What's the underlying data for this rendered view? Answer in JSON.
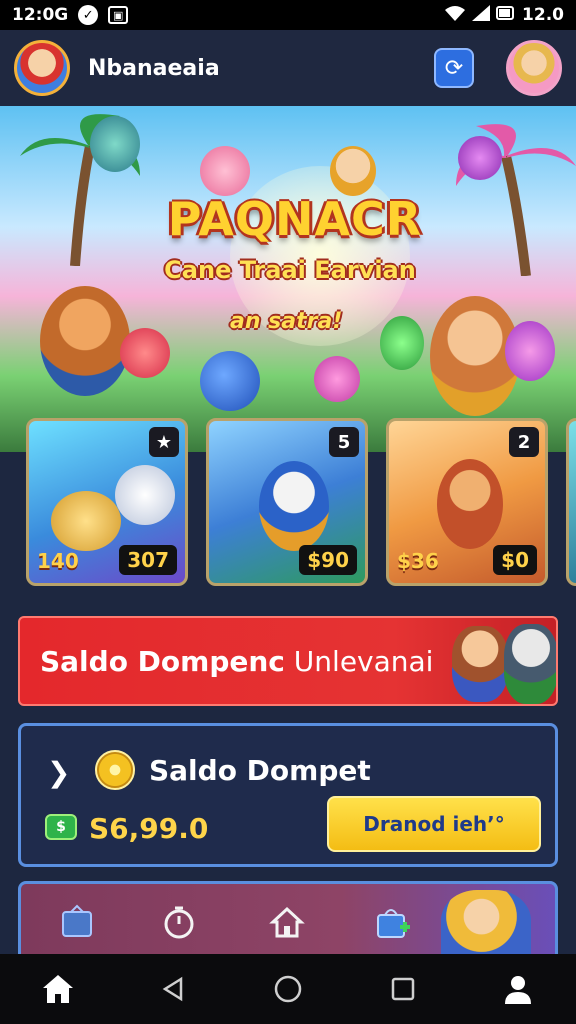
{
  "status_bar": {
    "time": "12:0G",
    "right_text": "12.0"
  },
  "header": {
    "title": "Nbanaeaia"
  },
  "hero": {
    "title": "PAQNACR",
    "subtitle": "Cane Traai Earvian",
    "tagline": "an satra!"
  },
  "cards": [
    {
      "badge": "★",
      "left_value": "140",
      "price": "307"
    },
    {
      "badge": "5",
      "left_value": "",
      "price": "$90"
    },
    {
      "badge": "2",
      "left_value": "$36",
      "price": "$0"
    }
  ],
  "promo": {
    "bold_text": "Saldo Dompenc",
    "thin_text": " Unlevanai"
  },
  "wallet": {
    "title": "Saldo Dompet",
    "amount": "S6,99.0",
    "button_label": "Dranod ieh’°"
  },
  "colors": {
    "accent_yellow": "#ffd24a",
    "promo_red": "#e4282c",
    "wallet_border": "#5a8fe0"
  }
}
